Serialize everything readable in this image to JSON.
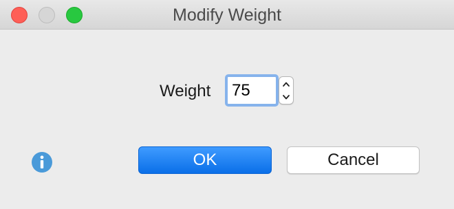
{
  "window": {
    "title": "Modify Weight"
  },
  "form": {
    "weight_label": "Weight",
    "weight_value": "75"
  },
  "buttons": {
    "ok_label": "OK",
    "cancel_label": "Cancel"
  },
  "icons": {
    "info": "info-icon",
    "stepper_up": "chevron-up-icon",
    "stepper_down": "chevron-down-icon"
  },
  "colors": {
    "accent": "#0a6fe8",
    "focus_ring": "#86b3ec",
    "info": "#4a9ad9",
    "close": "#fe5f57",
    "zoom": "#28c840"
  }
}
